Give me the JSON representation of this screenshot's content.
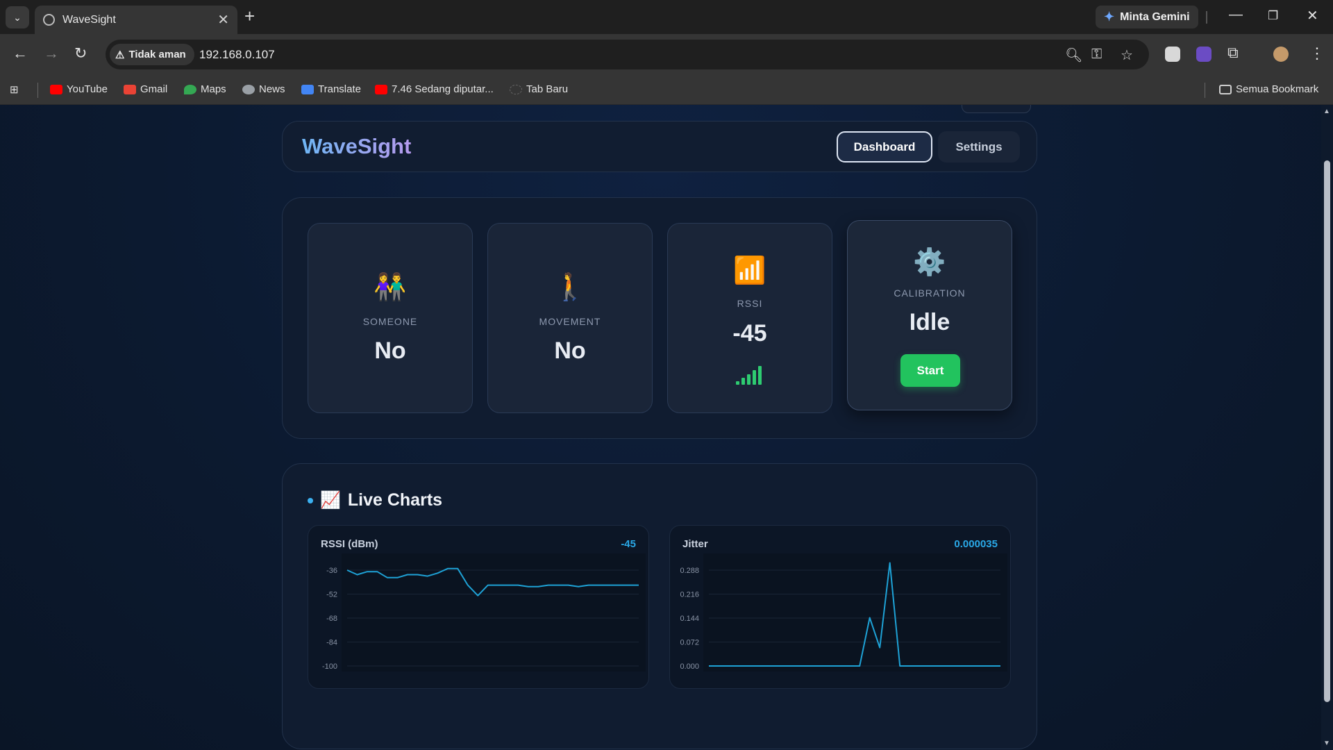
{
  "browser": {
    "tab_title": "WaveSight",
    "gemini_label": "Minta Gemini",
    "security_label": "Tidak aman",
    "url": "192.168.0.107",
    "bookmarks": [
      "YouTube",
      "Gmail",
      "Maps",
      "News",
      "Translate",
      "7.46 Sedang diputar...",
      "Tab Baru"
    ],
    "all_bookmarks": "Semua Bookmark"
  },
  "app": {
    "brand": "WaveSight",
    "nav": {
      "dashboard": "Dashboard",
      "settings": "Settings"
    }
  },
  "status": {
    "someone": {
      "icon": "👫",
      "label": "SOMEONE",
      "value": "No"
    },
    "movement": {
      "icon": "🚶",
      "label": "MOVEMENT",
      "value": "No"
    },
    "rssi": {
      "icon": "📶",
      "label": "RSSI",
      "value": "-45"
    },
    "calibration": {
      "icon": "⚙️",
      "label": "CALIBRATION",
      "value": "Idle",
      "button": "Start"
    }
  },
  "charts": {
    "title": "Live Charts",
    "icon": "📈",
    "rssi": {
      "name": "RSSI (dBm)",
      "current": "-45"
    },
    "jitter": {
      "name": "Jitter",
      "current": "0.000035"
    }
  },
  "colors": {
    "accent": "#2aa9e8",
    "success": "#22c35e",
    "line": "#1ea2d6"
  },
  "chart_data": [
    {
      "type": "line",
      "title": "RSSI (dBm)",
      "ylim": [
        -100,
        -36
      ],
      "yticks": [
        "-36",
        "-52",
        "-68",
        "-84",
        "-100"
      ],
      "grid": true,
      "series": [
        {
          "values": [
            -36,
            -39,
            -37,
            -37,
            -41,
            -41,
            -39,
            -39,
            -40,
            -38,
            -35,
            -35,
            -46,
            -53,
            -46,
            -46,
            -46,
            -46,
            -47,
            -47,
            -46,
            -46,
            -46,
            -47,
            -46,
            -46,
            -46,
            -46,
            -46,
            -46
          ]
        }
      ]
    },
    {
      "type": "line",
      "title": "Jitter",
      "ylim": [
        0,
        0.288
      ],
      "yticks": [
        "0.288",
        "0.216",
        "0.144",
        "0.072",
        "0.000"
      ],
      "grid": true,
      "series": [
        {
          "values": [
            0,
            0,
            0,
            0,
            0,
            0,
            0,
            0,
            0,
            0,
            0,
            0,
            0,
            0,
            0,
            0,
            0.145,
            0.055,
            0.31,
            0,
            0,
            0,
            0,
            0,
            0,
            0,
            0,
            0,
            0,
            0
          ]
        }
      ]
    }
  ]
}
